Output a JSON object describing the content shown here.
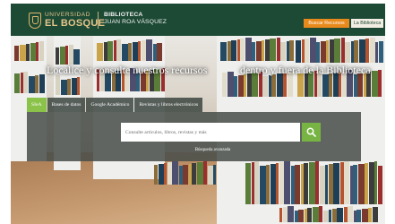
{
  "header": {
    "logo_small": "UNIVERSIDAD",
    "logo_big": "EL BOSQUE",
    "library_title": "BIBLIOTECA",
    "library_subtitle": "JUAN ROA VÁSQUEZ",
    "btn_primary": "Buscar Recursos",
    "btn_secondary": "La Biblioteca"
  },
  "hero": {
    "tagline_left": "Localice y consulte nuestros recursos",
    "tagline_right": "dentro y fuera de la Biblioteca"
  },
  "search": {
    "tabs": [
      "SIeA",
      "Bases de datos",
      "Google Académico",
      "Revistas y libros electrónicos"
    ],
    "active_tab": "SIeA",
    "placeholder": "Consulte artículos, libros, revistas y más",
    "advanced_label": "Búsqueda avanzada"
  },
  "colors": {
    "header_bg": "#1d4a35",
    "accent_orange": "#e88a1b",
    "accent_green": "#77b443",
    "logo_gold": "#e6c58b"
  }
}
